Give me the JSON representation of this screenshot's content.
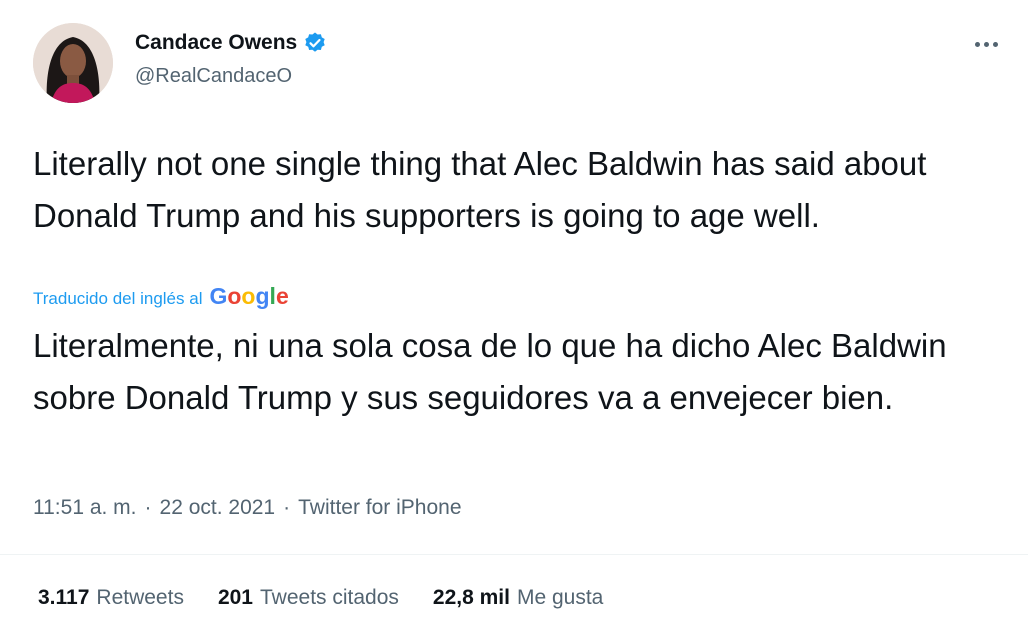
{
  "author": {
    "display_name": "Candace Owens",
    "handle": "@RealCandaceO",
    "verified": true
  },
  "tweet": {
    "text": "Literally not one single thing that Alec Baldwin has said about Donald Trump and his supporters is going to age well.",
    "translation_label": "Traducido del inglés al",
    "translation_provider": "Google",
    "translated_text": "Literalmente, ni una sola cosa de lo que ha dicho Alec Baldwin sobre Donald Trump y sus seguidores va a envejecer bien."
  },
  "meta": {
    "time": "11:51 a. m.",
    "sep1": "·",
    "date": "22 oct. 2021",
    "sep2": "·",
    "source": "Twitter for iPhone"
  },
  "stats": {
    "retweets_count": "3.117",
    "retweets_label": "Retweets",
    "quotes_count": "201",
    "quotes_label": "Tweets citados",
    "likes_count": "22,8 mil",
    "likes_label": "Me gusta"
  },
  "icons": {
    "verified": "verified-badge-icon",
    "more": "more-options-icon"
  },
  "colors": {
    "accent": "#1d9bf0",
    "text": "#0f1419",
    "secondary": "#536471"
  }
}
